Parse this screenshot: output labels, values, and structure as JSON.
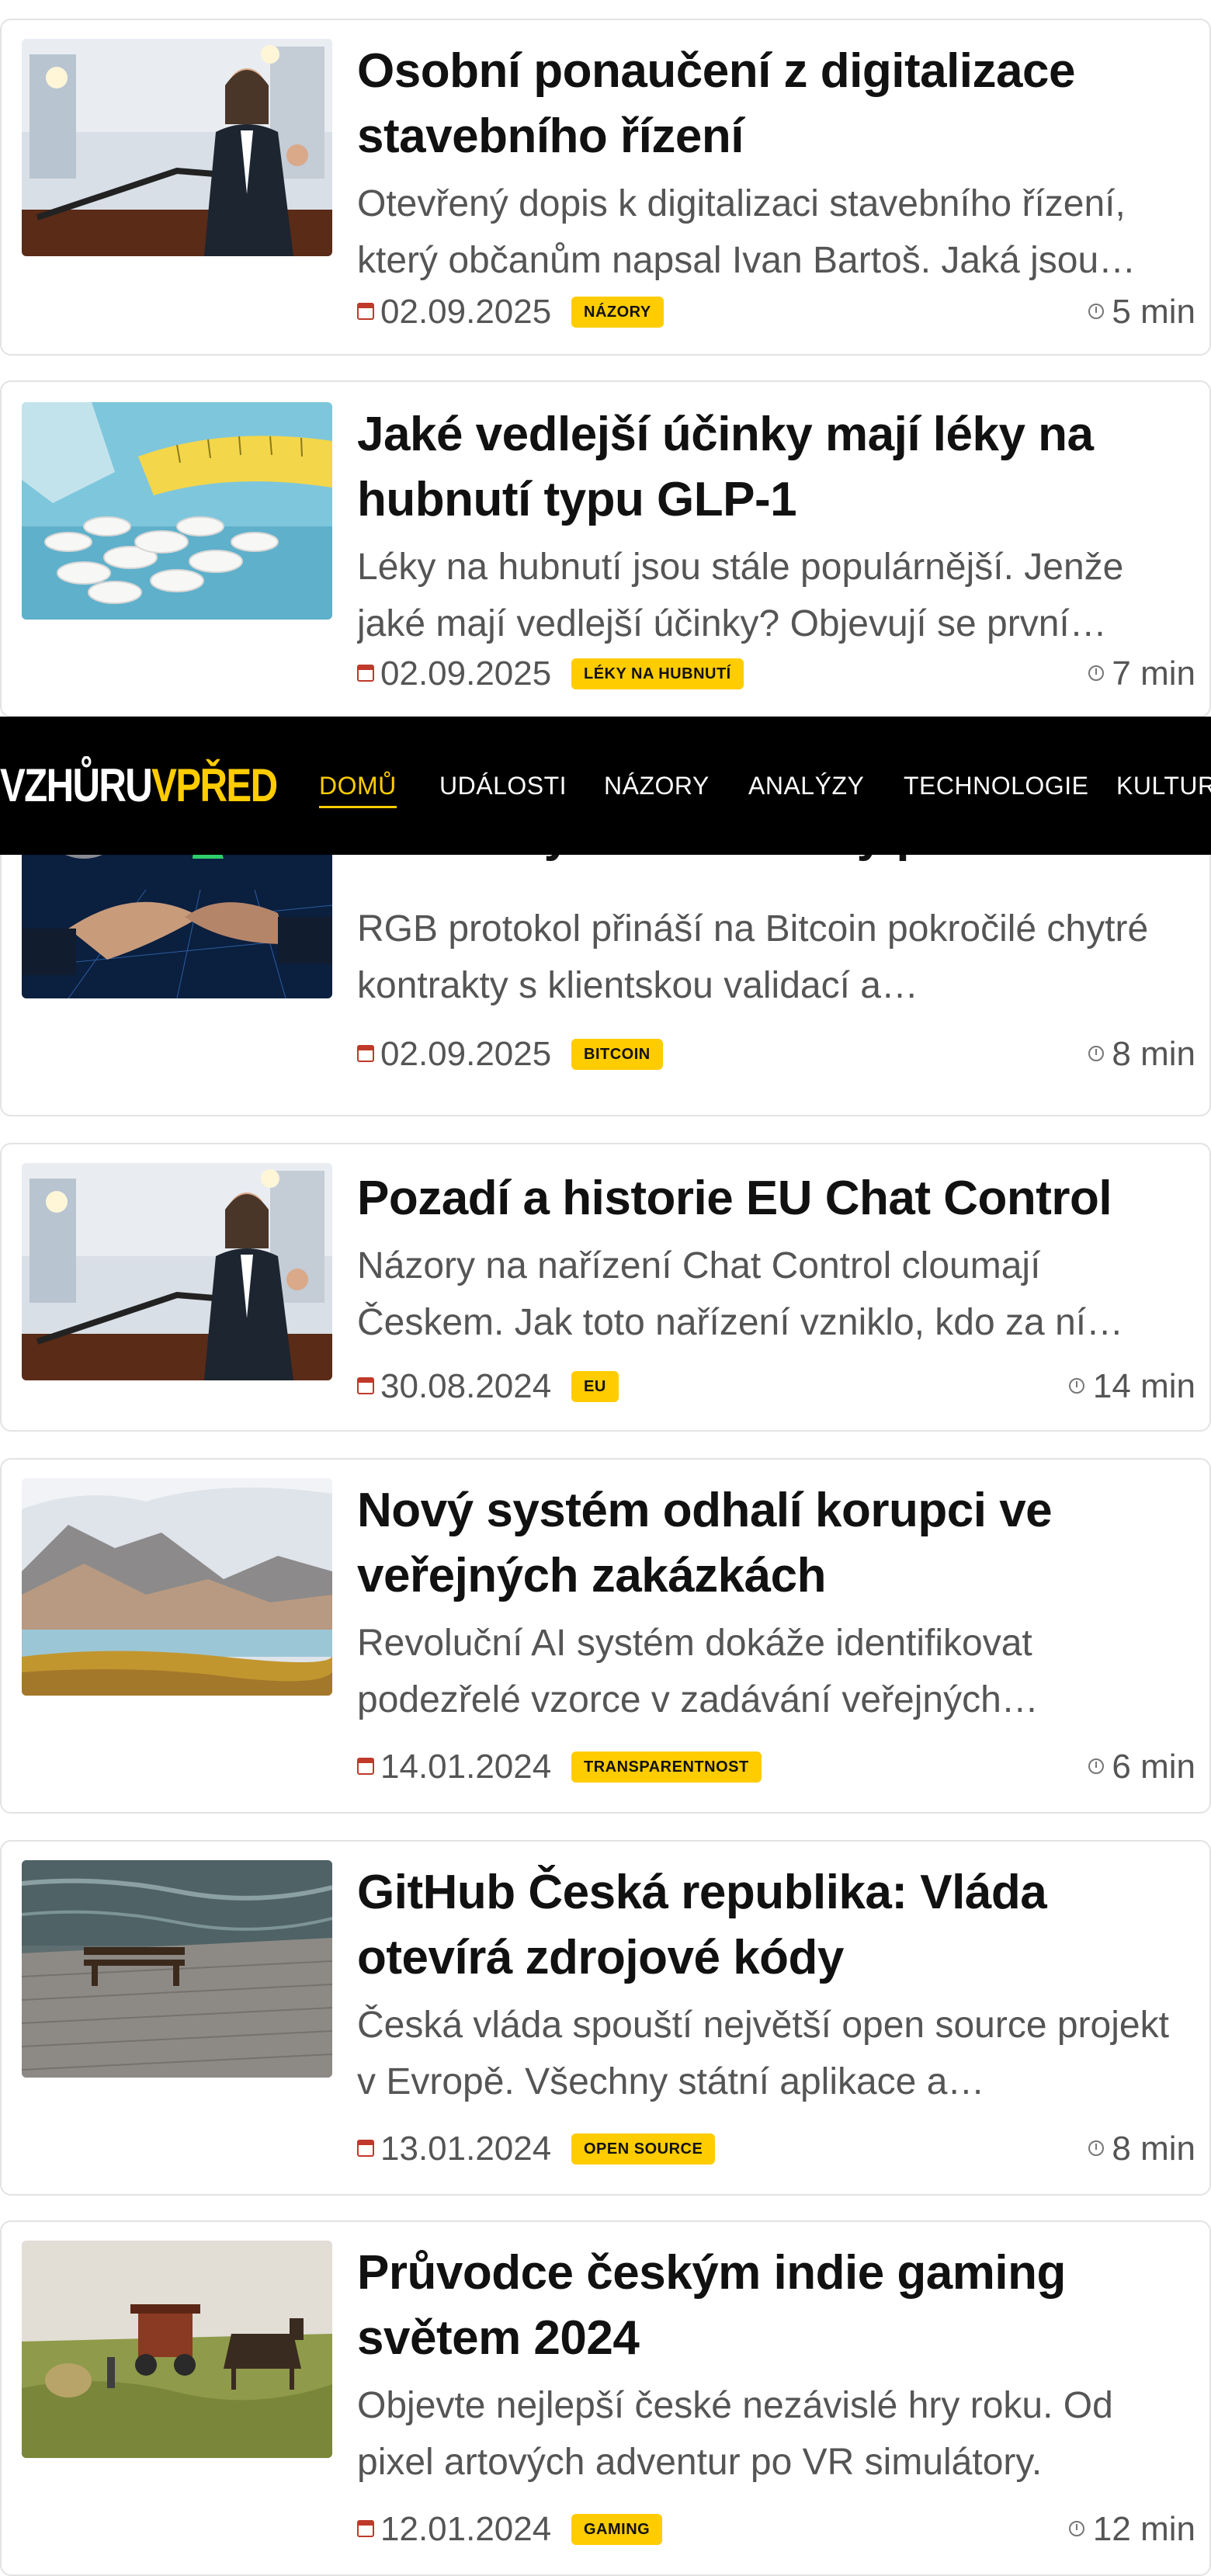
{
  "nav": {
    "logo_white": "VZHŮRU",
    "logo_yellow": "VPŘED",
    "items": [
      {
        "label": "DOMŮ",
        "active": true
      },
      {
        "label": "UDÁLOSTI"
      },
      {
        "label": "NÁZORY"
      },
      {
        "label": "ANALÝZY"
      },
      {
        "label": "TECHNOLOGIE"
      },
      {
        "label": "KULTURA"
      }
    ]
  },
  "colors": {
    "accent": "#ffcc00",
    "nav_bg": "#000000"
  },
  "articles": [
    {
      "title": "Osobní ponaučení z digitalizace stavebního řízení",
      "excerpt": "Otevřený dopis k digitalizaci stavebního řízení, který občanům napsal Ivan Bartoš. Jaká jsou…",
      "date": "02.09.2025",
      "tag": "NÁZORY",
      "read": "5 min",
      "image": "speaker-at-podium"
    },
    {
      "title": "Jaké vedlejší účinky mají léky na hubnutí typu GLP-1",
      "excerpt": "Léky na hubnutí jsou stále populárnější. Jenže jaké mají vedlejší účinky? Objevují se první…",
      "date": "02.09.2025",
      "tag": "LÉKY NA HUBNUTÍ",
      "read": "7 min",
      "image": "pills-and-measuring-tape"
    },
    {
      "title": "kontrakty a stablecoiny přímo na…",
      "excerpt": "RGB protokol přináší na Bitcoin pokročilé chytré kontrakty s klientskou validací a…",
      "date": "02.09.2025",
      "tag": "BITCOIN",
      "read": "8 min",
      "image": "bitcoin-handshake"
    },
    {
      "title": "Pozadí a historie EU Chat Control",
      "excerpt": "Názory na nařízení Chat Control cloumají Českem. Jak toto nařízení vzniklo, kdo za ní…",
      "date": "30.08.2024",
      "tag": "EU",
      "read": "14 min",
      "image": "speaker-at-podium"
    },
    {
      "title": "Nový systém odhalí korupci ve veřejných zakázkách",
      "excerpt": "Revoluční AI systém dokáže identifikovat podezřelé vzorce v zadávání veřejných…",
      "date": "14.01.2024",
      "tag": "TRANSPARENTNOST",
      "read": "6 min",
      "image": "mountain-lake-landscape"
    },
    {
      "title": "GitHub Česká republika: Vláda otevírá zdrojové kódy",
      "excerpt": "Česká vláda spouští největší open source projekt v Evropě. Všechny státní aplikace a…",
      "date": "13.01.2024",
      "tag": "OPEN SOURCE",
      "read": "8 min",
      "image": "bench-on-pier"
    },
    {
      "title": "Průvodce českým indie gaming světem 2024",
      "excerpt": "Objevte nejlepší české nezávislé hry roku. Od pixel artových adventur po VR simulátory.",
      "date": "12.01.2024",
      "tag": "GAMING",
      "read": "12 min",
      "image": "horses-hay-field"
    }
  ]
}
